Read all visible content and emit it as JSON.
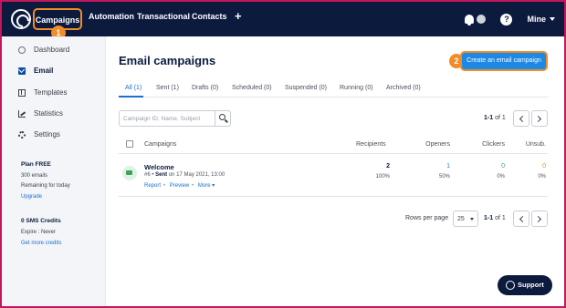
{
  "topnav": {
    "items": [
      "Campaigns",
      "Automation",
      "Transactional",
      "Contacts"
    ],
    "add_label": "+",
    "help_label": "?",
    "account_label": "Mine",
    "callout_campaigns": "1"
  },
  "sidebar": {
    "items": [
      {
        "label": "Dashboard",
        "icon": "dashboard-icon"
      },
      {
        "label": "Email",
        "icon": "email-icon"
      },
      {
        "label": "Templates",
        "icon": "templates-icon"
      },
      {
        "label": "Statistics",
        "icon": "statistics-icon"
      },
      {
        "label": "Settings",
        "icon": "settings-icon"
      }
    ],
    "plan": {
      "title": "Plan FREE",
      "emails": "300 emails",
      "remaining": "Remaining for today",
      "upgrade": "Upgrade"
    },
    "sms": {
      "title": "0 SMS Credits",
      "expire": "Expire : Never",
      "get_more": "Get more credits"
    }
  },
  "main": {
    "title": "Email campaigns",
    "create_button": "Create an email campaign",
    "callout_create": "2",
    "tabs": [
      "All (1)",
      "Sent (1)",
      "Drafts (0)",
      "Scheduled (0)",
      "Suspended (0)",
      "Running (0)",
      "Archived (0)"
    ],
    "search_placeholder": "Campaign ID, Name, Subject",
    "pager_range": "1-1",
    "pager_of": "of 1",
    "table": {
      "headers": [
        "Campaigns",
        "Recipients",
        "Openers",
        "Clickers",
        "Unsub."
      ],
      "rows": [
        {
          "name": "Welcome",
          "id": "#6 •",
          "status": "Sent",
          "date": "on 17 May 2021, 13:00",
          "links": [
            "Report",
            "Preview",
            "More ▾"
          ],
          "recipients": "2",
          "recipients_pct": "100%",
          "openers": "1",
          "openers_pct": "50%",
          "clickers": "0",
          "clickers_pct": "0%",
          "unsub": "0",
          "unsub_pct": "0%"
        }
      ]
    },
    "rows_per_page_label": "Rows per page",
    "rows_per_page_value": "25",
    "bottom_pager_range": "1-1",
    "bottom_pager_of": "of 1"
  },
  "support_label": "Support",
  "colors": {
    "nav_bg": "#0b1a3d",
    "accent": "#1e88e5",
    "callout": "#f28c28",
    "openers": "#1e88e5",
    "clickers": "#3aa55a",
    "unsub": "#f28c28"
  }
}
